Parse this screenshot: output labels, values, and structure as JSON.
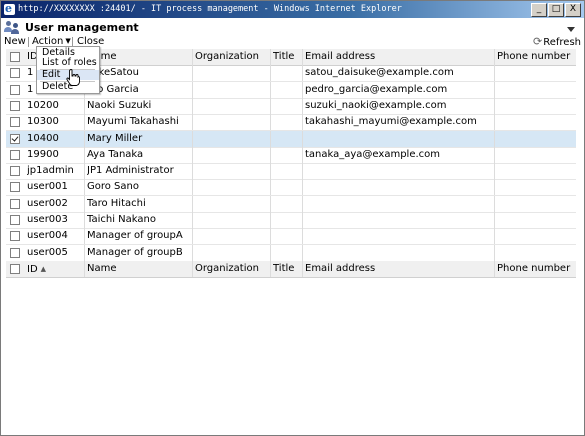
{
  "window": {
    "title": "http://XXXXXXXX :24401/ - IT process management - Windows Internet Explorer",
    "controls": [
      "_",
      "□",
      "X"
    ]
  },
  "app": {
    "title": "User management",
    "icon": "users-icon"
  },
  "toolbar": {
    "new_label": "New",
    "action_label": "Action",
    "close_label": "Close",
    "refresh_label": "Refresh"
  },
  "action_menu": {
    "items": [
      "Details",
      "List of roles",
      "Edit",
      "Delete"
    ],
    "hovered": "Edit"
  },
  "table": {
    "columns": [
      "ID",
      "Name",
      "Organization",
      "Title",
      "Email address",
      "Phone number"
    ],
    "sort_indicator": "▲",
    "rows": [
      {
        "id": "1",
        "name": "sukeSatou",
        "organization": "",
        "title": "",
        "email": "satou_daisuke@example.com",
        "phone": "",
        "checked": false
      },
      {
        "id": "1",
        "name": "dro Garcia",
        "organization": "",
        "title": "",
        "email": "pedro_garcia@example.com",
        "phone": "",
        "checked": false
      },
      {
        "id": "10200",
        "name": "Naoki Suzuki",
        "organization": "",
        "title": "",
        "email": "suzuki_naoki@example.com",
        "phone": "",
        "checked": false
      },
      {
        "id": "10300",
        "name": "Mayumi Takahashi",
        "organization": "",
        "title": "",
        "email": "takahashi_mayumi@example.com",
        "phone": "",
        "checked": false
      },
      {
        "id": "10400",
        "name": "Mary Miller",
        "organization": "",
        "title": "",
        "email": "",
        "phone": "",
        "checked": true
      },
      {
        "id": "19900",
        "name": "Aya Tanaka",
        "organization": "",
        "title": "",
        "email": "tanaka_aya@example.com",
        "phone": "",
        "checked": false
      },
      {
        "id": "jp1admin",
        "name": "JP1 Administrator",
        "organization": "",
        "title": "",
        "email": "",
        "phone": "",
        "checked": false
      },
      {
        "id": "user001",
        "name": "Goro Sano",
        "organization": "",
        "title": "",
        "email": "",
        "phone": "",
        "checked": false
      },
      {
        "id": "user002",
        "name": "Taro Hitachi",
        "organization": "",
        "title": "",
        "email": "",
        "phone": "",
        "checked": false
      },
      {
        "id": "user003",
        "name": "Taichi Nakano",
        "organization": "",
        "title": "",
        "email": "",
        "phone": "",
        "checked": false
      },
      {
        "id": "user004",
        "name": "Manager of groupA",
        "organization": "",
        "title": "",
        "email": "",
        "phone": "",
        "checked": false
      },
      {
        "id": "user005",
        "name": "Manager of groupB",
        "organization": "",
        "title": "",
        "email": "",
        "phone": "",
        "checked": false
      }
    ]
  }
}
